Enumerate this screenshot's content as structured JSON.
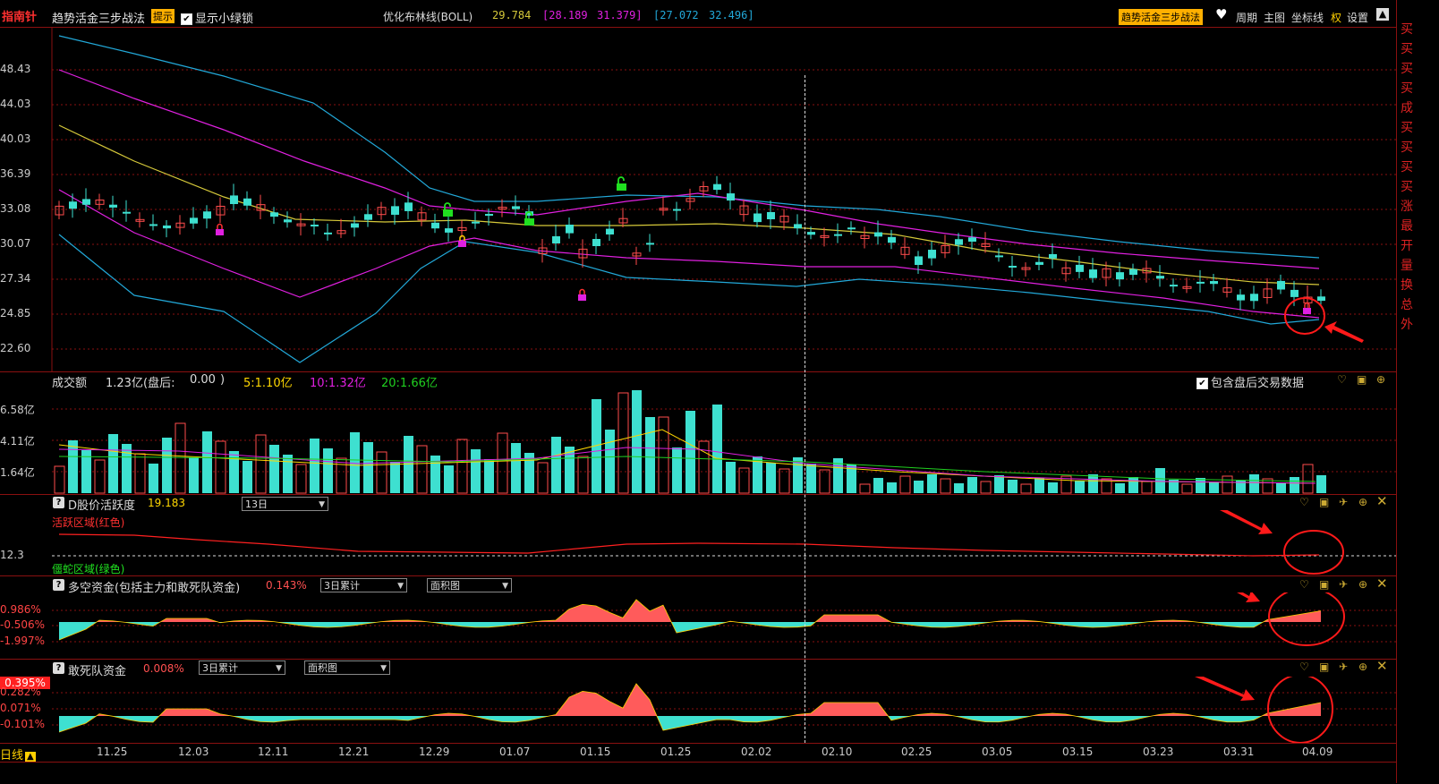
{
  "header": {
    "logo": "指南针",
    "strategy": "趋势活金三步战法",
    "hint_badge": "提示",
    "show_lock_label": "显示小绿锁",
    "boll_title": "优化布林线(BOLL)",
    "boll_v1": "29.784",
    "boll_v2": "[28.189",
    "boll_v3": "31.379]",
    "boll_v4": "[27.072",
    "boll_v5": "32.496]",
    "right_strategy": "趋势活金三步战法",
    "period": "周期",
    "main_chart": "主图",
    "axis": "坐标线",
    "rights": "权",
    "settings": "设置"
  },
  "colors": {
    "up": "#ff4d4d",
    "down": "#3ee0d0",
    "boll_mid": "#d6c93a",
    "boll_in": "#e020e0",
    "boll_out": "#22a8d8",
    "sep": "#8a1010",
    "grid": "#8a1010"
  },
  "main_axis": [
    "48.43",
    "44.03",
    "40.03",
    "36.39",
    "33.08",
    "30.07",
    "27.34",
    "24.85",
    "22.60"
  ],
  "x_axis": [
    "11.25",
    "12.03",
    "12.11",
    "12.21",
    "12.29",
    "01.07",
    "01.15",
    "01.25",
    "02.02",
    "02.10",
    "02.25",
    "03.05",
    "03.15",
    "03.23",
    "03.31",
    "04.09"
  ],
  "volume": {
    "title": "成交额",
    "v1": "1.23亿",
    "after_label": "(盘后:",
    "after_value": "0.00",
    "after_close": ")",
    "ma5": "5:1.10亿",
    "ma10": "10:1.32亿",
    "ma20": "20:1.66亿",
    "include_after": "包含盘后交易数据",
    "axis": [
      "6.58亿",
      "4.11亿",
      "1.64亿"
    ]
  },
  "activity": {
    "title": "D股价活跃度",
    "value": "19.183",
    "select": "13日",
    "zone_red": "活跃区域(红色)",
    "zone_green": "僵蛇区域(绿色)",
    "axis": [
      "12.3"
    ]
  },
  "funds": {
    "title": "多空资金(包括主力和敢死队资金)",
    "value": "0.143%",
    "select1": "3日累计",
    "select2": "面积图",
    "axis": [
      "0.986%",
      "-0.506%",
      "-1.997%"
    ]
  },
  "dare": {
    "title": "敢死队资金",
    "value": "0.008%",
    "select1": "3日累计",
    "select2": "面积图",
    "badge": "0.395%",
    "axis": [
      "0.282%",
      "0.071%",
      "-0.101%"
    ]
  },
  "footer": {
    "period": "日线"
  },
  "right_col": [
    "买",
    "买",
    "买",
    "买",
    "成",
    "买",
    "买",
    "买",
    "买",
    "涨",
    "最",
    "开",
    "量",
    "换",
    "总",
    "外"
  ]
}
